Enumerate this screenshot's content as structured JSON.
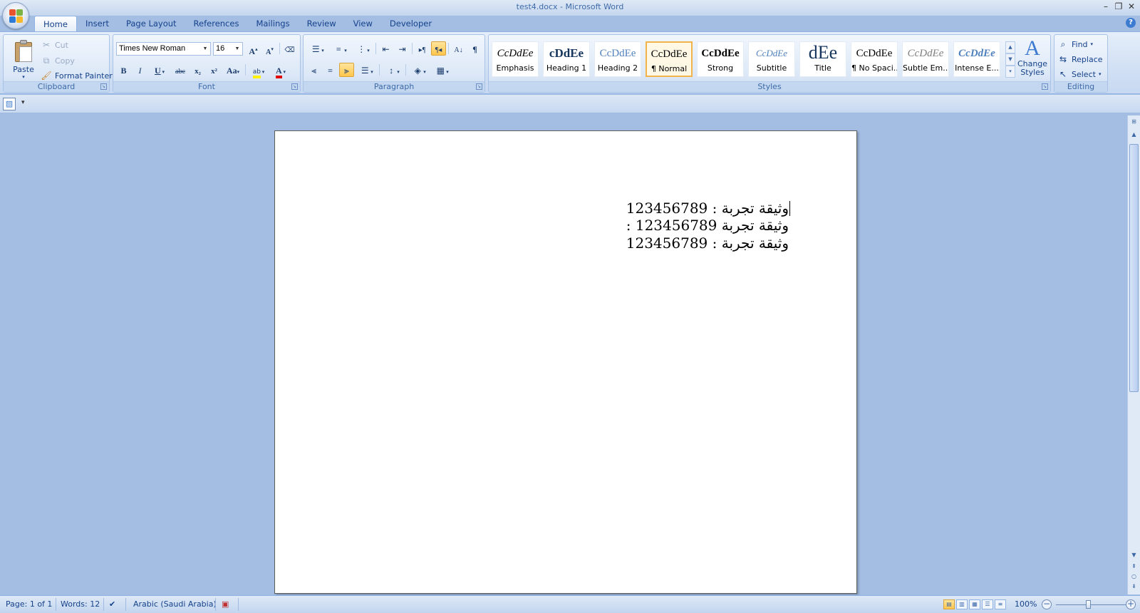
{
  "window": {
    "title": "test4.docx - Microsoft Word",
    "controls": [
      "–",
      "❐",
      "✕"
    ]
  },
  "tabs": [
    {
      "label": "Home",
      "active": true
    },
    {
      "label": "Insert"
    },
    {
      "label": "Page Layout"
    },
    {
      "label": "References"
    },
    {
      "label": "Mailings"
    },
    {
      "label": "Review"
    },
    {
      "label": "View"
    },
    {
      "label": "Developer"
    }
  ],
  "clipboard": {
    "label": "Clipboard",
    "paste": "Paste",
    "cut": "Cut",
    "copy": "Copy",
    "format_painter": "Format Painter"
  },
  "font": {
    "label": "Font",
    "name": "Times New Roman",
    "size": "16",
    "grow": "A",
    "shrink": "A",
    "bold": "B",
    "italic": "I",
    "underline": "U",
    "strike": "abc",
    "subscript": "x₂",
    "superscript": "x²",
    "change_case": "Aa",
    "highlight": "ab",
    "font_color": "A"
  },
  "paragraph": {
    "label": "Paragraph",
    "show_marks": "¶"
  },
  "styles": {
    "label": "Styles",
    "items": [
      {
        "sample": "CcDdEe",
        "name": "Emphasis"
      },
      {
        "sample": "cDdEe",
        "name": "Heading 1"
      },
      {
        "sample": "CcDdEe",
        "name": "Heading 2"
      },
      {
        "sample": "CcDdEe",
        "name": "¶ Normal",
        "active": true
      },
      {
        "sample": "CcDdEe",
        "name": "Strong"
      },
      {
        "sample": "CcDdEe",
        "name": "Subtitle"
      },
      {
        "sample": "dEe",
        "name": "Title"
      },
      {
        "sample": "CcDdEe",
        "name": "¶ No Spaci..."
      },
      {
        "sample": "CcDdEe",
        "name": "Subtle Em..."
      },
      {
        "sample": "CcDdEe",
        "name": "Intense E..."
      }
    ],
    "change_styles": "Change Styles"
  },
  "editing": {
    "label": "Editing",
    "find": "Find",
    "replace": "Replace",
    "select": "Select"
  },
  "document": {
    "lines": [
      "وثيقة تجربة : 123456789",
      "وثيقة تجربة 123456789 :",
      "وثيقة تجربة : 123456789"
    ]
  },
  "status": {
    "page": "Page: 1 of 1",
    "words": "Words: 12",
    "language": "Arabic (Saudi Arabia)",
    "zoom": "100%"
  },
  "colors": {
    "accent": "#15428b",
    "ribbon_bg": "#d1e0f4",
    "doc_area": "#a3bde3",
    "highlight": "#ffc64d"
  }
}
